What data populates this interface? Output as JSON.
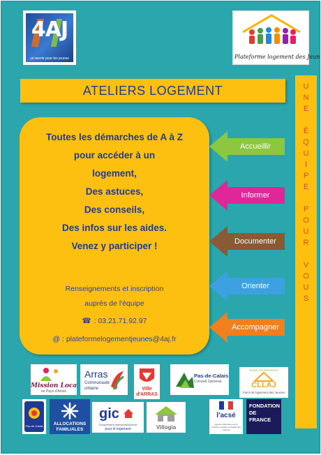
{
  "logos_top": {
    "aj": {
      "mark": "4AJ",
      "tagline": "un avenir pour les jeunes"
    },
    "plateforme": {
      "caption": "Plateforme logement des Jeunes"
    }
  },
  "title": "ATELIERS LOGEMENT",
  "side_banner": {
    "letters": [
      "U",
      "N",
      "E",
      "",
      "É",
      "Q",
      "U",
      "I",
      "P",
      "E",
      "",
      "P",
      "O",
      "U",
      "R",
      "",
      "V",
      "O",
      "U",
      "S"
    ]
  },
  "main": {
    "lines": [
      "Toutes les démarches de A à Z",
      "pour accéder à un",
      "logement,",
      "Des astuces,",
      "Des conseils,",
      "Des infos sur les aides.",
      "Venez y participer !"
    ],
    "info": [
      "Renseignements et inscription",
      "auprès de l'équipe"
    ],
    "phone_icon": "☎",
    "phone": ": 03.21.71.92.97",
    "email": "@ : plateformelogementjeunes@4aj.fr"
  },
  "arrows": [
    {
      "label": "Accueillir",
      "color": "#8dc63f"
    },
    {
      "label": "Informer",
      "color": "#e0279a"
    },
    {
      "label": "Documenter",
      "color": "#8a5a34"
    },
    {
      "label": "Orienter",
      "color": "#3da0e0"
    },
    {
      "label": "Accompagner",
      "color": "#f07f1c"
    }
  ],
  "partners": {
    "mission_locale": {
      "name": "Mission Locale",
      "sub": "en Pays d'Artois"
    },
    "arras_cu": {
      "name": "Arras",
      "sub1": "Communauté",
      "sub2": "urbaine"
    },
    "ville_arras": {
      "name": "Ville",
      "sub": "d'ARRAS"
    },
    "pas_de_calais": {
      "name": "Pas-de-Calais",
      "sub": "Conseil Général"
    },
    "cllaj": {
      "name": "CLLAJ",
      "top": "Soyez les bienvenus",
      "sub": "Point de logement des Jeunes"
    },
    "pnf": {
      "name": "Pas-de-Calais"
    },
    "caf": {
      "name": "ALLOCATIONS",
      "sub": "FAMILIALES"
    },
    "gic": {
      "name": "gic",
      "sub": "Groupement Interprofessionnel",
      "sub2": "pour le logement"
    },
    "villogia": {
      "name": "Villogia"
    },
    "acse": {
      "name": "l'acsé",
      "sub": "Agence nationale pour la cohésion sociale et l'égalité des chances"
    },
    "fondation": {
      "line1": "FONDATION",
      "line2": "DE",
      "line3": "FRANCE"
    }
  },
  "colors": {
    "background": "#2aa6ac",
    "yellow": "#fdc010",
    "navy": "#1f3a93",
    "orange_text": "#d2501a"
  }
}
